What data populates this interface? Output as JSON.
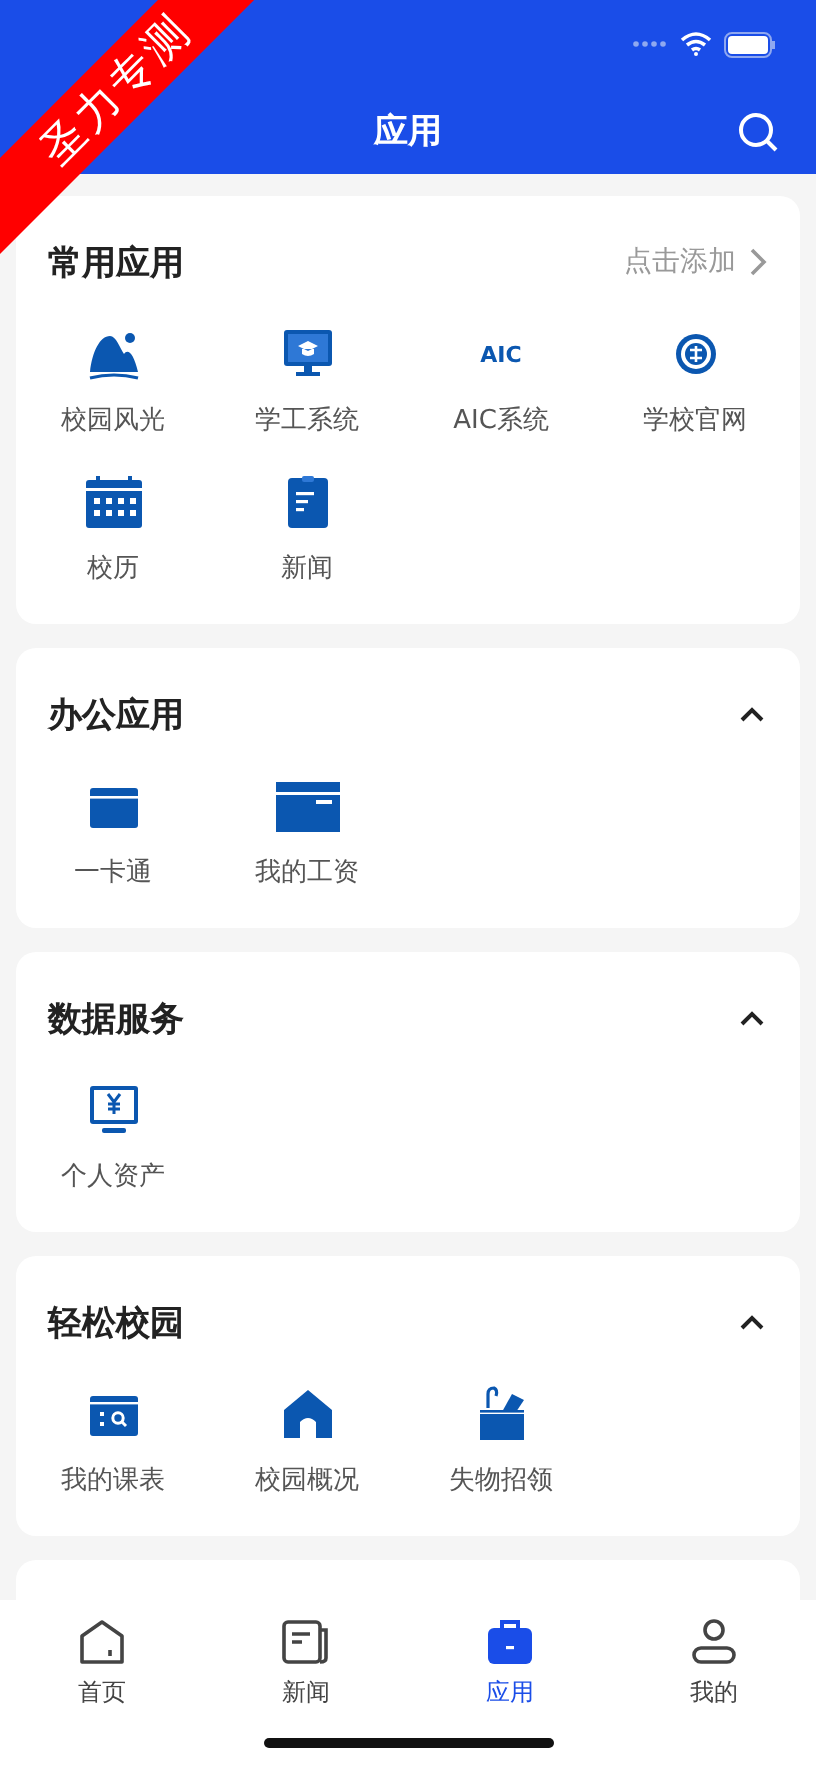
{
  "ribbon": {
    "text": "圣力专测"
  },
  "header": {
    "title": "应用"
  },
  "sections": [
    {
      "title": "常用应用",
      "kind": "addable",
      "action": "点击添加",
      "apps": [
        {
          "label": "校园风光",
          "kind": "mountain"
        },
        {
          "label": "学工系统",
          "kind": "monitor"
        },
        {
          "label": "AIC系统",
          "kind": "lettermark",
          "icon_text": "AIC"
        },
        {
          "label": "学校官网",
          "kind": "emblem"
        },
        {
          "label": "校历",
          "kind": "calendar"
        },
        {
          "label": "新闻",
          "kind": "document"
        }
      ]
    },
    {
      "title": "办公应用",
      "kind": "collapsible",
      "expanded": true,
      "apps": [
        {
          "label": "一卡通",
          "kind": "card"
        },
        {
          "label": "我的工资",
          "kind": "wallet"
        }
      ]
    },
    {
      "title": "数据服务",
      "kind": "collapsible",
      "expanded": true,
      "apps": [
        {
          "label": "个人资产",
          "kind": "yen"
        }
      ]
    },
    {
      "title": "轻松校园",
      "kind": "collapsible",
      "expanded": true,
      "apps": [
        {
          "label": "我的课表",
          "kind": "schedule"
        },
        {
          "label": "校园概况",
          "kind": "house"
        },
        {
          "label": "失物招领",
          "kind": "box"
        }
      ]
    }
  ],
  "tabbar": [
    {
      "label": "首页",
      "kind": "home",
      "selected": false
    },
    {
      "label": "新闻",
      "kind": "news",
      "selected": false
    },
    {
      "label": "应用",
      "kind": "briefcase",
      "selected": true
    },
    {
      "label": "我的",
      "kind": "person",
      "selected": false
    }
  ]
}
